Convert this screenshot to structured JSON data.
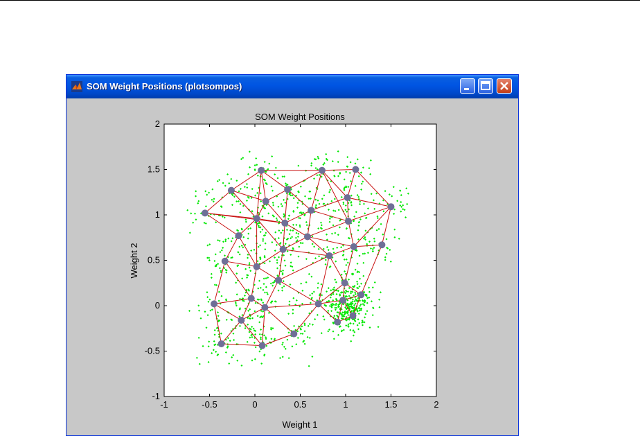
{
  "window": {
    "title": "SOM Weight Positions (plotsompos)",
    "buttons": [
      "minimize",
      "maximize",
      "close"
    ]
  },
  "colors": {
    "data_points": "#00e800",
    "neurons": "#6f6f97",
    "links": "#c81010"
  },
  "chart_data": {
    "type": "scatter",
    "title": "SOM Weight Positions",
    "xlabel": "Weight 1",
    "ylabel": "Weight 2",
    "xlim": [
      -1,
      2
    ],
    "ylim": [
      -1,
      2
    ],
    "xticks": [
      "-1",
      "-0.5",
      "0",
      "0.5",
      "1",
      "1.5",
      "2"
    ],
    "yticks": [
      "-1",
      "-0.5",
      "0",
      "0.5",
      "1",
      "1.5",
      "2"
    ],
    "grid": false,
    "neurons": [
      [
        0.07,
        1.49
      ],
      [
        0.74,
        1.49
      ],
      [
        1.11,
        1.5
      ],
      [
        -0.26,
        1.27
      ],
      [
        0.36,
        1.28
      ],
      [
        0.12,
        1.15
      ],
      [
        1.02,
        1.19
      ],
      [
        -0.55,
        1.02
      ],
      [
        0.62,
        1.05
      ],
      [
        1.5,
        1.09
      ],
      [
        0.02,
        0.96
      ],
      [
        0.33,
        0.91
      ],
      [
        1.03,
        0.93
      ],
      [
        -0.18,
        0.77
      ],
      [
        0.58,
        0.76
      ],
      [
        0.31,
        0.62
      ],
      [
        1.09,
        0.65
      ],
      [
        1.4,
        0.67
      ],
      [
        -0.33,
        0.49
      ],
      [
        0.82,
        0.55
      ],
      [
        0.02,
        0.43
      ],
      [
        0.26,
        0.28
      ],
      [
        -0.04,
        0.08
      ],
      [
        0.99,
        0.25
      ],
      [
        1.17,
        0.12
      ],
      [
        -0.45,
        0.02
      ],
      [
        0.11,
        -0.02
      ],
      [
        0.7,
        0.02
      ],
      [
        0.97,
        0.06
      ],
      [
        -0.15,
        -0.16
      ],
      [
        1.08,
        -0.11
      ],
      [
        0.91,
        -0.18
      ],
      [
        0.43,
        -0.31
      ],
      [
        -0.37,
        -0.42
      ],
      [
        0.08,
        -0.44
      ]
    ],
    "links": [
      [
        0,
        1
      ],
      [
        1,
        2
      ],
      [
        0,
        3
      ],
      [
        0,
        4
      ],
      [
        0,
        5
      ],
      [
        0,
        10
      ],
      [
        1,
        4
      ],
      [
        1,
        8
      ],
      [
        1,
        6
      ],
      [
        1,
        12
      ],
      [
        2,
        6
      ],
      [
        2,
        9
      ],
      [
        3,
        7
      ],
      [
        3,
        5
      ],
      [
        3,
        10
      ],
      [
        4,
        5
      ],
      [
        4,
        11
      ],
      [
        4,
        8
      ],
      [
        5,
        10
      ],
      [
        5,
        11
      ],
      [
        6,
        8
      ],
      [
        6,
        9
      ],
      [
        6,
        12
      ],
      [
        7,
        10
      ],
      [
        7,
        13
      ],
      [
        7,
        11
      ],
      [
        8,
        11
      ],
      [
        8,
        12
      ],
      [
        8,
        14
      ],
      [
        9,
        12
      ],
      [
        9,
        16
      ],
      [
        9,
        17
      ],
      [
        10,
        11
      ],
      [
        10,
        13
      ],
      [
        10,
        15
      ],
      [
        10,
        20
      ],
      [
        11,
        14
      ],
      [
        11,
        15
      ],
      [
        12,
        14
      ],
      [
        12,
        16
      ],
      [
        13,
        18
      ],
      [
        13,
        20
      ],
      [
        14,
        15
      ],
      [
        14,
        19
      ],
      [
        14,
        16
      ],
      [
        15,
        20
      ],
      [
        15,
        21
      ],
      [
        15,
        19
      ],
      [
        16,
        17
      ],
      [
        16,
        19
      ],
      [
        16,
        23
      ],
      [
        17,
        24
      ],
      [
        18,
        20
      ],
      [
        18,
        25
      ],
      [
        18,
        22
      ],
      [
        19,
        21
      ],
      [
        19,
        23
      ],
      [
        19,
        27
      ],
      [
        20,
        21
      ],
      [
        20,
        22
      ],
      [
        21,
        26
      ],
      [
        21,
        27
      ],
      [
        22,
        25
      ],
      [
        22,
        26
      ],
      [
        22,
        29
      ],
      [
        23,
        24
      ],
      [
        23,
        28
      ],
      [
        23,
        27
      ],
      [
        24,
        30
      ],
      [
        24,
        28
      ],
      [
        25,
        29
      ],
      [
        25,
        33
      ],
      [
        26,
        29
      ],
      [
        26,
        32
      ],
      [
        26,
        34
      ],
      [
        26,
        27
      ],
      [
        27,
        28
      ],
      [
        27,
        31
      ],
      [
        27,
        32
      ],
      [
        28,
        30
      ],
      [
        28,
        31
      ],
      [
        30,
        31
      ],
      [
        29,
        33
      ],
      [
        29,
        34
      ],
      [
        32,
        34
      ],
      [
        33,
        34
      ]
    ],
    "scatter_points": 1100
  }
}
